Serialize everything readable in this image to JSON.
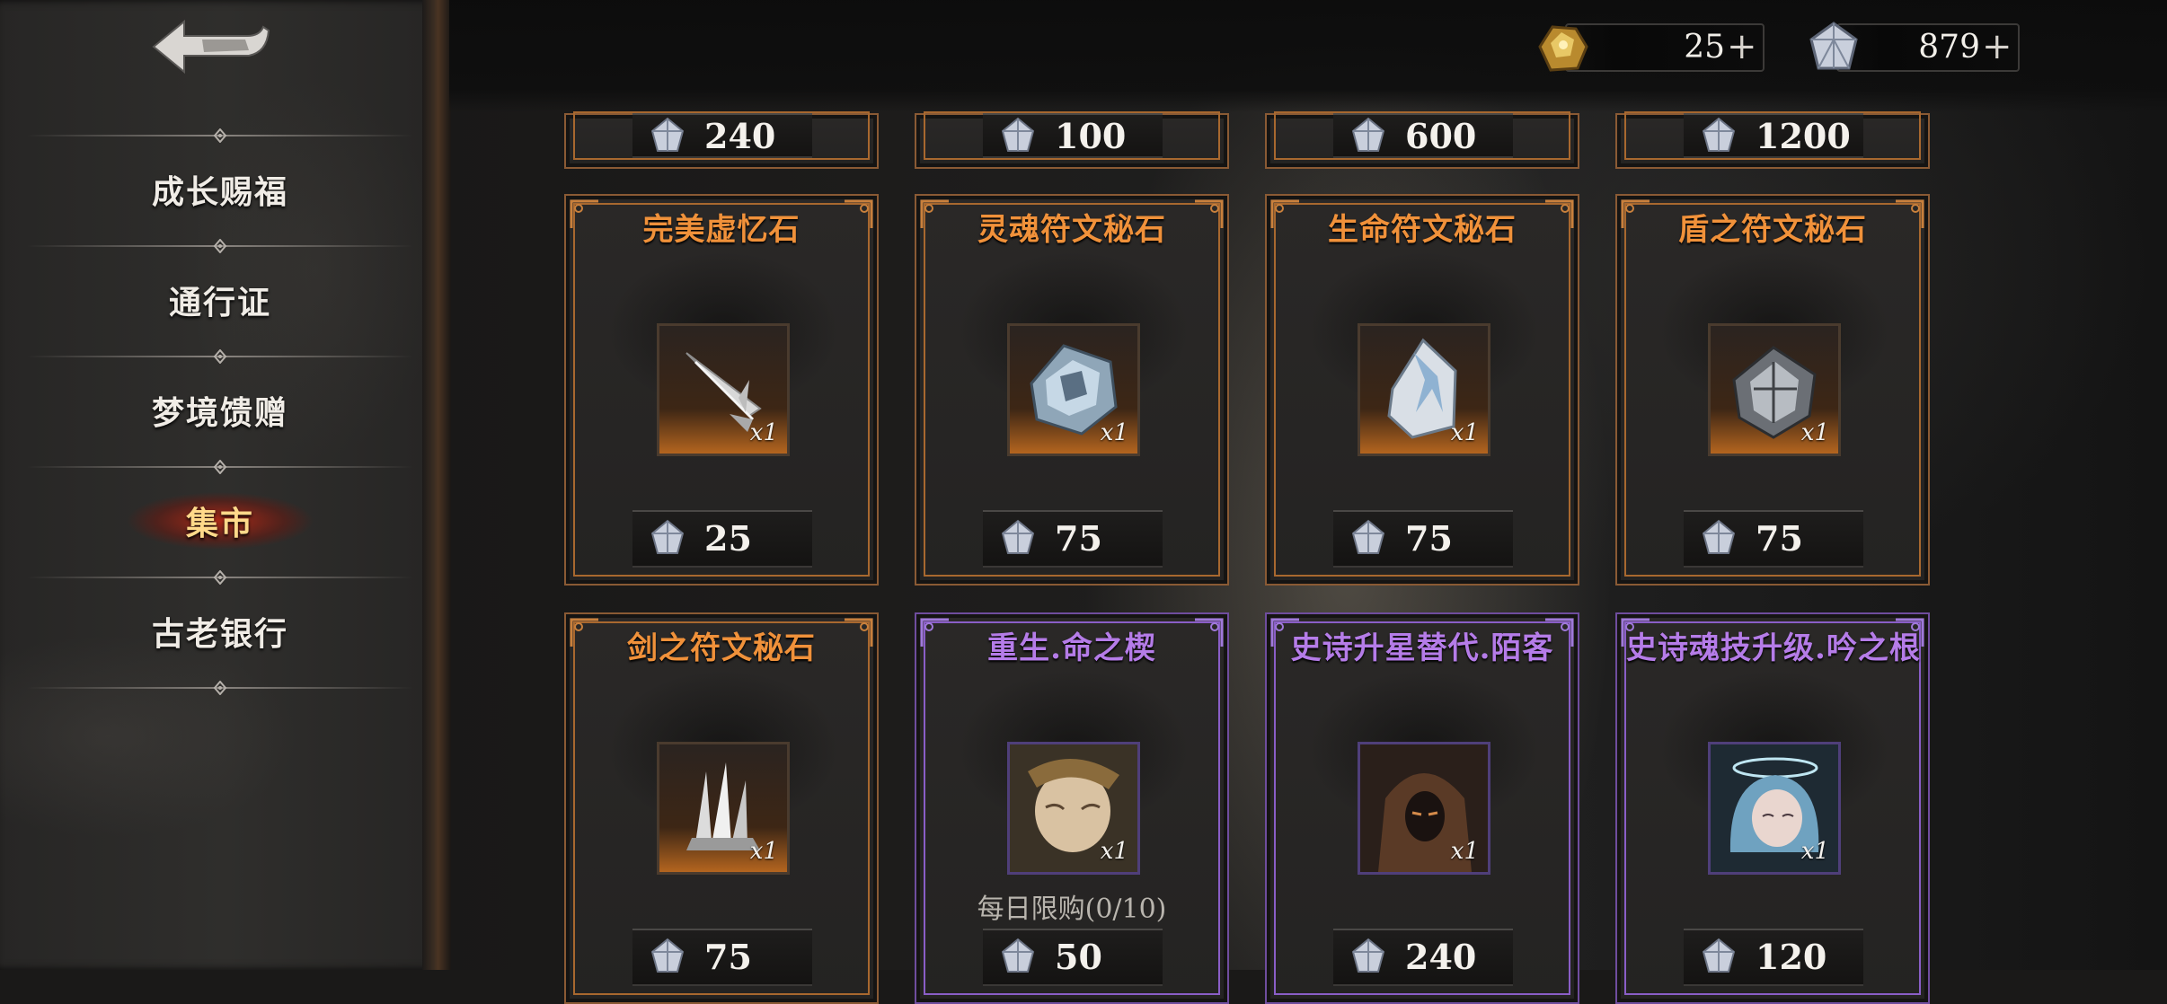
{
  "colors": {
    "orange_title": "#f0913a",
    "purple_title": "#b57ce8",
    "active_nav": "#ffd98a"
  },
  "sidebar": {
    "back_icon": "back-arrow-icon",
    "items": [
      {
        "label": "成长赐福",
        "active": false
      },
      {
        "label": "通行证",
        "active": false
      },
      {
        "label": "梦境馈赠",
        "active": false
      },
      {
        "label": "集市",
        "active": true
      },
      {
        "label": "古老银行",
        "active": false
      }
    ]
  },
  "currencies": {
    "gold": {
      "icon": "gold-nugget-icon",
      "amount": "25"
    },
    "crystal": {
      "icon": "crystal-gem-icon",
      "amount": "879"
    },
    "plus": "+"
  },
  "shop": {
    "top_row_prices": [
      "240",
      "100",
      "600",
      "1200"
    ],
    "row1": [
      {
        "title": "完美虚忆石",
        "rarity": "orange",
        "icon": "silver-feather-icon",
        "qty": "x1",
        "price": "25"
      },
      {
        "title": "灵魂符文秘石",
        "rarity": "orange",
        "icon": "soul-rune-stone-icon",
        "qty": "x1",
        "price": "75"
      },
      {
        "title": "生命符文秘石",
        "rarity": "orange",
        "icon": "life-rune-stone-icon",
        "qty": "x1",
        "price": "75"
      },
      {
        "title": "盾之符文秘石",
        "rarity": "orange",
        "icon": "shield-rune-stone-icon",
        "qty": "x1",
        "price": "75"
      }
    ],
    "row2": [
      {
        "title": "剑之符文秘石",
        "rarity": "orange",
        "icon": "sword-rune-stone-icon",
        "qty": "x1",
        "price": "75",
        "limit": ""
      },
      {
        "title": "重生.命之楔",
        "rarity": "purple",
        "icon": "sleeping-face-portrait-icon",
        "qty": "x1",
        "price": "50",
        "limit": "每日限购(0/10)"
      },
      {
        "title": "史诗升星替代.陌客",
        "rarity": "purple",
        "icon": "hooded-stranger-portrait-icon",
        "qty": "x1",
        "price": "240",
        "limit": ""
      },
      {
        "title": "史诗魂技升级.吟之根",
        "rarity": "purple",
        "icon": "blue-hair-girl-portrait-icon",
        "qty": "x1",
        "price": "120",
        "limit": ""
      }
    ]
  }
}
